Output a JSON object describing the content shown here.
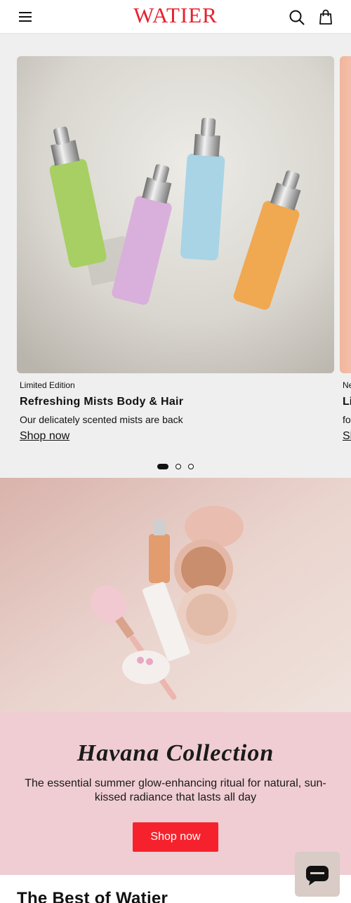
{
  "header": {
    "logo": "WATIER",
    "menu_icon": "hamburger-menu-icon",
    "search_icon": "search-icon",
    "bag_icon": "shopping-bag-icon",
    "brand_color": "#e8202e"
  },
  "carousel": {
    "slides": [
      {
        "eyebrow": "Limited Edition",
        "title": "Refreshing Mists Body & Hair",
        "subtitle": "Our delicately scented mists are back",
        "link": "Shop now"
      }
    ],
    "next_peek": {
      "eyebrow": "Ne",
      "title": "Li",
      "subtitle": "fo",
      "link": "Sh"
    },
    "pagination": {
      "count": 3,
      "active": 1
    }
  },
  "havana": {
    "title": "Havana Collection",
    "description": "The essential summer glow-enhancing ritual for natural, sun-kissed radiance that lasts all day",
    "button": "Shop now",
    "panel_color": "#efcdd3",
    "button_color": "#f5222d"
  },
  "best": {
    "title": "The Best of Watier"
  },
  "chat": {
    "icon": "chat-bubble-icon"
  }
}
